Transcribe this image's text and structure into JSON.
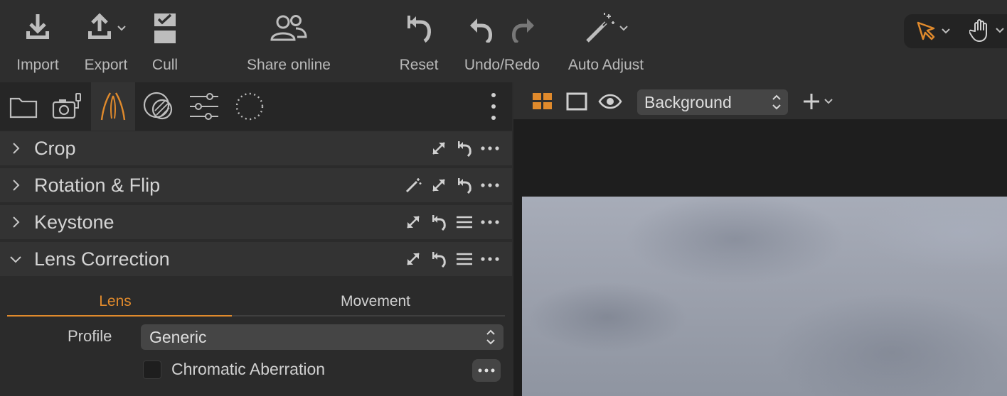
{
  "toolbar": {
    "import_label": "Import",
    "export_label": "Export",
    "cull_label": "Cull",
    "share_label": "Share online",
    "reset_label": "Reset",
    "undo_redo_label": "Undo/Redo",
    "auto_adjust_label": "Auto Adjust"
  },
  "tool_tabs": [
    {
      "icon": "folder-icon"
    },
    {
      "icon": "camera-tether-icon"
    },
    {
      "icon": "lens-icon",
      "active": true
    },
    {
      "icon": "color-icon"
    },
    {
      "icon": "adjustments-icon"
    },
    {
      "icon": "dotted-circle-icon"
    }
  ],
  "panels": {
    "crop": {
      "title": "Crop"
    },
    "rotation": {
      "title": "Rotation & Flip"
    },
    "keystone": {
      "title": "Keystone"
    },
    "lens_correction": {
      "title": "Lens Correction",
      "tabs": [
        "Lens",
        "Movement"
      ],
      "active_tab": "Lens",
      "profile_label": "Profile",
      "profile_value": "Generic",
      "chromatic_label": "Chromatic Aberration",
      "chromatic_checked": false
    }
  },
  "viewer": {
    "background_value": "Background"
  },
  "colors": {
    "accent": "#e08a2c",
    "background": "#2b2b2b",
    "viewer_background": "#1e1e1e"
  }
}
